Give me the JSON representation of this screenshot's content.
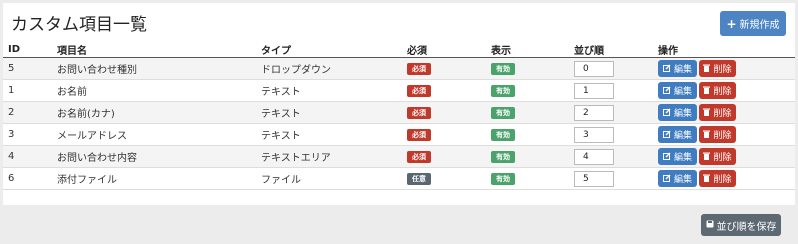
{
  "header": {
    "title": "カスタム項目一覧",
    "new_button_icon": "+",
    "new_button_label": "新規作成"
  },
  "table": {
    "columns": [
      "ID",
      "項目名",
      "タイプ",
      "必須",
      "表示",
      "並び順",
      "操作"
    ],
    "rows": [
      {
        "id": "5",
        "name": "お問い合わせ種別",
        "type": "ドロップダウン",
        "required": "必須",
        "visible": "有効",
        "order": "0"
      },
      {
        "id": "1",
        "name": "お名前",
        "type": "テキスト",
        "required": "必須",
        "visible": "有効",
        "order": "1"
      },
      {
        "id": "2",
        "name": "お名前(カナ)",
        "type": "テキスト",
        "required": "必須",
        "visible": "有効",
        "order": "2"
      },
      {
        "id": "3",
        "name": "メールアドレス",
        "type": "テキスト",
        "required": "必須",
        "visible": "有効",
        "order": "3"
      },
      {
        "id": "4",
        "name": "お問い合わせ内容",
        "type": "テキストエリア",
        "required": "必須",
        "visible": "有効",
        "order": "4"
      },
      {
        "id": "6",
        "name": "添付ファイル",
        "type": "ファイル",
        "required": "任意",
        "visible": "有効",
        "order": "5"
      }
    ],
    "edit_label": "編集",
    "delete_label": "削除",
    "edit_icon": "edit-icon",
    "delete_icon": "trash-icon"
  },
  "footer": {
    "save_label": "並び順を保存",
    "save_icon": "save-icon"
  },
  "colors": {
    "primary": "#4d84c4",
    "danger": "#c0392b",
    "success": "#4aa36b",
    "secondary": "#5c6872"
  }
}
